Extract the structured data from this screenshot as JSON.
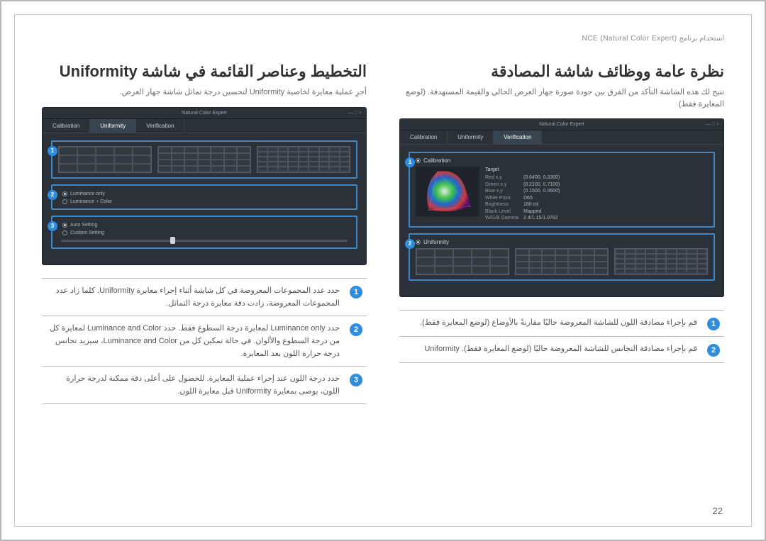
{
  "header_line": "استخدام برنامج NCE (Natural Color Expert)",
  "page_number": "22",
  "app_window_title": "Natural Color Expert",
  "app_tabs": {
    "calibration": "Calibration",
    "uniformity": "Uniformity",
    "verification": "Verification"
  },
  "left_screenshot": {
    "panel1_label": "Calibration",
    "target_heading": "Target",
    "targets": {
      "red": {
        "lbl": "Red x,y",
        "val": "(0.6400, 0.3300)"
      },
      "green": {
        "lbl": "Green x,y",
        "val": "(0.2100, 0.7100)"
      },
      "blue": {
        "lbl": "Blue x,y",
        "val": "(0.1500, 0.0600)"
      },
      "white": {
        "lbl": "White Point",
        "val": "D65"
      },
      "brightness": {
        "lbl": "Brightness",
        "val": "160 cd"
      },
      "blacklevel": {
        "lbl": "Black Level",
        "val": "Mapped"
      },
      "wgb": {
        "lbl": "W/G/B Gamma",
        "val": "2.4/1.15/1.0762"
      }
    },
    "panel2_label": "Uniformity"
  },
  "right_screenshot": {
    "panel1_grids": [
      "3x5",
      "5x7",
      "7x9"
    ],
    "panel2_options": {
      "opt1": "Luminance only",
      "opt2": "Luminance + Color"
    },
    "panel3": {
      "auto": "Auto Setting",
      "custom": "Custom Setting"
    }
  },
  "right_col": {
    "title": "التخطيط وعناصر القائمة في شاشة Uniformity",
    "subtitle": "أجرِ عملية معايرة لخاصية Uniformity لتحسين درجة تماثل شاشة جهاز العرض.",
    "rows": {
      "r1": "حدد عدد المجموعات المعروضة في كل شاشة أثناء إجراء معايرة Uniformity. كلما زاد عدد المجموعات المعروضة، زادت دقة معايرة درجة التماثل.",
      "r2": "حدد Luminance only لمعايرة درجة السطوع فقط. حدد Luminance and Color لمعايرة كل من درجة السطوع والألوان. في حالة تمكين كل من Luminance and Color، سيزيد تجانس درجة حرارة اللون بعد المعايرة.",
      "r3": "حدد درجة اللون عند إجراء عملية المعايرة. للحصول على أعلى دقة ممكنة لدرجة حرارة اللون، يوصى بمعايرة Uniformity قبل معايرة اللون."
    },
    "num1": "1",
    "num2": "2",
    "num3": "3"
  },
  "left_col": {
    "title": "نظرة عامة ووظائف شاشة المصادقة",
    "subtitle": "تتيح لك هذه الشاشة التأكد من الفرق بين جودة صورة جهاز العرض الحالي والقيمة المستهدفة. (لوضع المعايرة فقط)",
    "rows": {
      "r1": "قم بإجراء مصادقة اللون للشاشة المعروضة حاليًا مقارنةً بالأوضاع (لوضع المعايرة فقط).",
      "r2": "قم بإجراء مصادقة التجانس للشاشة المعروضة حاليًا (لوضع المعايرة فقط). Uniformity"
    },
    "num1": "1",
    "num2": "2"
  }
}
